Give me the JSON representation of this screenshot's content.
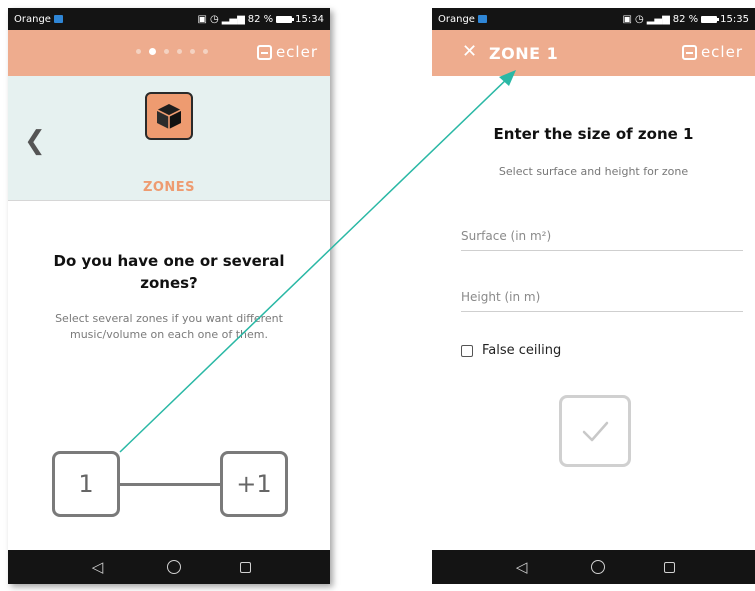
{
  "status_left": {
    "carrier": "Orange",
    "battery": "82 %",
    "time": "15:34"
  },
  "status_right": {
    "carrier": "Orange",
    "battery": "82 %",
    "time": "15:35"
  },
  "brand": {
    "logo_text": "ecler"
  },
  "left": {
    "zones_label": "ZONES",
    "question": "Do you have one or several zones?",
    "hint": "Select several zones if you want different music/volume on each one of them.",
    "option_one": "1",
    "option_several": "+1",
    "pager": {
      "count": 6,
      "active_index": 1
    }
  },
  "right": {
    "title": "ZONE 1",
    "heading": "Enter the size of zone 1",
    "subheading": "Select surface and height for zone",
    "surface_placeholder": "Surface (in m²)",
    "height_placeholder": "Height (in m)",
    "false_ceiling_label": "False ceiling",
    "false_ceiling_checked": false
  },
  "icons": {
    "back": "chevron-left-icon",
    "close": "close-icon",
    "zone": "cube-icon",
    "confirm": "checkmark-icon"
  },
  "colors": {
    "accent": "#eeac8e",
    "zone_panel": "#e6f1f0",
    "arrow": "#2ab8a5",
    "label": "#ee9b70"
  }
}
